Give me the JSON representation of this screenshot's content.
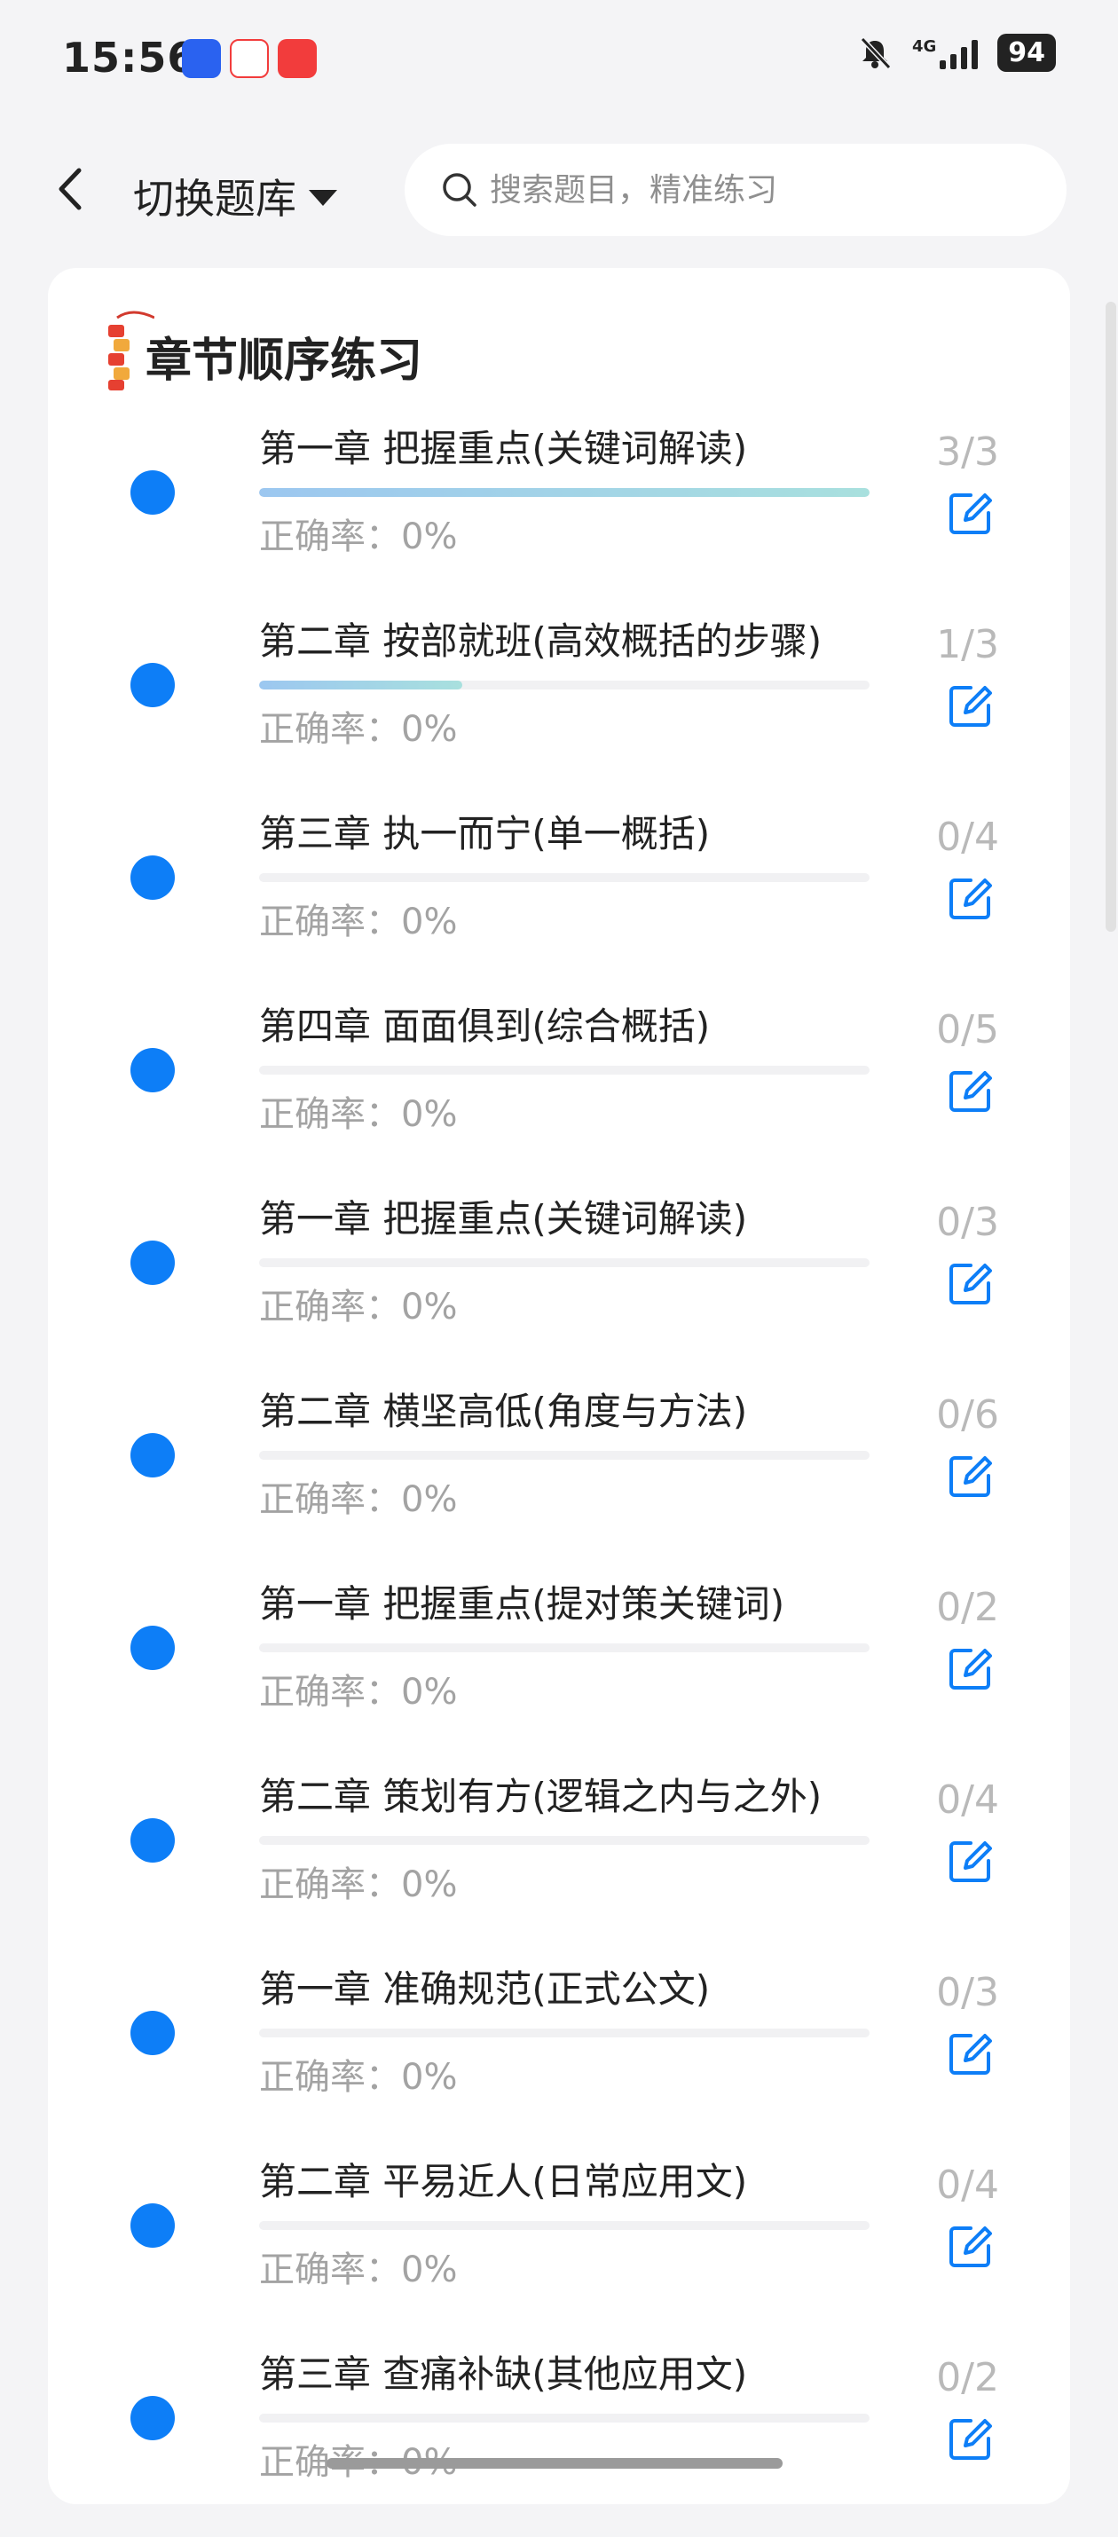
{
  "status": {
    "time": "15:56",
    "network": "4G",
    "battery": "94"
  },
  "header": {
    "bank_label": "切换题库",
    "search_placeholder": "搜索题目，精准练习"
  },
  "section": {
    "title": "章节顺序练习"
  },
  "chapters": [
    {
      "title": "第一章 把握重点(关键词解读)",
      "accuracy": "正确率：0%",
      "count": "3/3",
      "progress": 1.0
    },
    {
      "title": "第二章 按部就班(高效概括的步骤)",
      "accuracy": "正确率：0%",
      "count": "1/3",
      "progress": 0.333
    },
    {
      "title": "第三章 执一而宁(单一概括)",
      "accuracy": "正确率：0%",
      "count": "0/4",
      "progress": 0
    },
    {
      "title": "第四章 面面俱到(综合概括)",
      "accuracy": "正确率：0%",
      "count": "0/5",
      "progress": 0
    },
    {
      "title": "第一章 把握重点(关键词解读)",
      "accuracy": "正确率：0%",
      "count": "0/3",
      "progress": 0
    },
    {
      "title": "第二章 横坚高低(角度与方法)",
      "accuracy": "正确率：0%",
      "count": "0/6",
      "progress": 0
    },
    {
      "title": "第一章 把握重点(提对策关键词)",
      "accuracy": "正确率：0%",
      "count": "0/2",
      "progress": 0
    },
    {
      "title": "第二章 策划有方(逻辑之内与之外)",
      "accuracy": "正确率：0%",
      "count": "0/4",
      "progress": 0
    },
    {
      "title": "第一章 准确规范(正式公文)",
      "accuracy": "正确率：0%",
      "count": "0/3",
      "progress": 0
    },
    {
      "title": "第二章 平易近人(日常应用文)",
      "accuracy": "正确率：0%",
      "count": "0/4",
      "progress": 0
    },
    {
      "title": "第三章 查痛补缺(其他应用文)",
      "accuracy": "正确率：0%",
      "count": "0/2",
      "progress": 0
    }
  ],
  "colors": {
    "accent": "#0d7ef7",
    "progress_start": "#9cc7f0",
    "progress_end": "#a8e0de"
  },
  "icons": {
    "back": "back-arrow-icon",
    "dropdown": "caret-down-icon",
    "search": "search-icon",
    "edit": "edit-icon",
    "section": "firecracker-icon"
  }
}
